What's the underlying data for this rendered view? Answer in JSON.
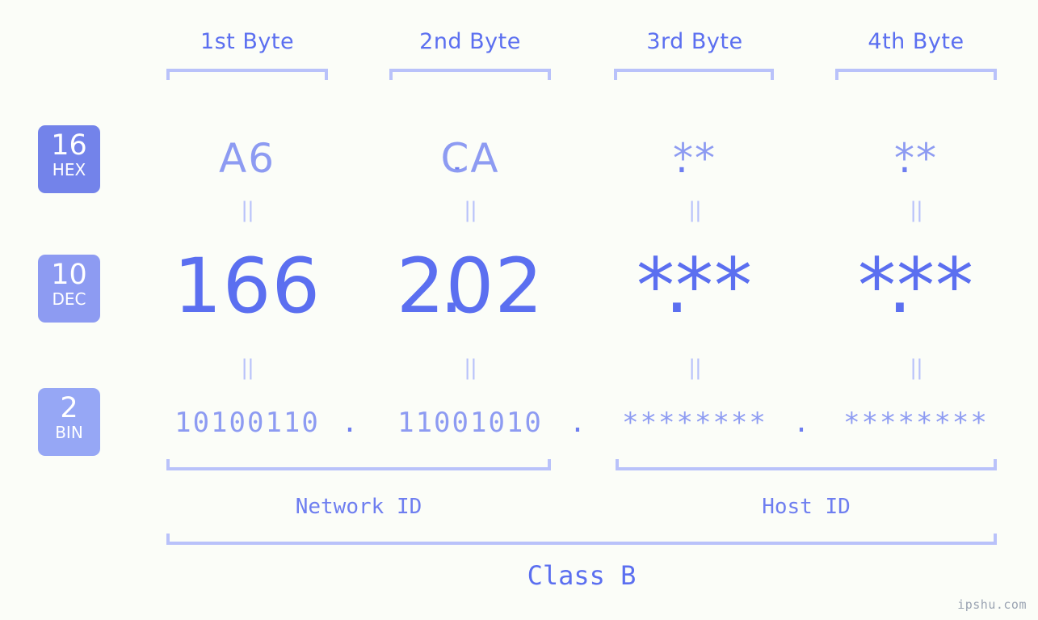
{
  "meta": {
    "background_color": "#fbfdf8",
    "accent_color": "#5b6ff0",
    "accent_light": "#8d9bf2",
    "bracket_color": "#b9c2fa",
    "watermark": "ipshu.com"
  },
  "byte_headers": [
    {
      "label": "1st Byte"
    },
    {
      "label": "2nd Byte"
    },
    {
      "label": "3rd Byte"
    },
    {
      "label": "4th Byte"
    }
  ],
  "bases": [
    {
      "number": "16",
      "abbr": "HEX",
      "color": "#7383ea"
    },
    {
      "number": "10",
      "abbr": "DEC",
      "color": "#8d9bf2"
    },
    {
      "number": "2",
      "abbr": "BIN",
      "color": "#96a7f5"
    }
  ],
  "rows": {
    "hex": {
      "values": [
        "A6",
        "CA",
        "**",
        "**"
      ],
      "separators": [
        ".",
        ".",
        "."
      ]
    },
    "dec": {
      "values": [
        "166",
        "202",
        "***",
        "***"
      ],
      "separators": [
        ".",
        ".",
        "."
      ]
    },
    "bin": {
      "values": [
        "10100110",
        "11001010",
        "********",
        "********"
      ],
      "separators": [
        ".",
        ".",
        "."
      ]
    }
  },
  "equality_markers": {
    "hex_to_dec": [
      "||",
      "||",
      "||",
      "||"
    ],
    "dec_to_bin": [
      "||",
      "||",
      "||",
      "||"
    ]
  },
  "sections": {
    "network_id": "Network ID",
    "host_id": "Host ID",
    "class": "Class B"
  }
}
